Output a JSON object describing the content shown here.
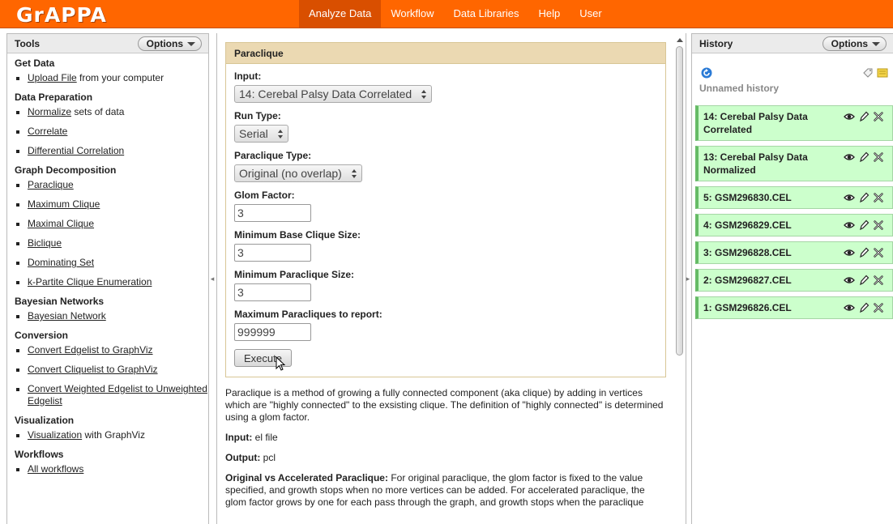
{
  "app": {
    "logo": "GrAPPA"
  },
  "nav": {
    "items": [
      {
        "label": "Analyze Data",
        "active": true
      },
      {
        "label": "Workflow",
        "active": false
      },
      {
        "label": "Data Libraries",
        "active": false
      },
      {
        "label": "Help",
        "active": false
      },
      {
        "label": "User",
        "active": false
      }
    ]
  },
  "tools": {
    "title": "Tools",
    "options_label": "Options",
    "sections": [
      {
        "name": "Get Data",
        "items": [
          {
            "link": "Upload File",
            "rest": " from your computer"
          }
        ]
      },
      {
        "name": "Data Preparation",
        "items": [
          {
            "link": "Normalize",
            "rest": " sets of data"
          },
          {
            "link": "Correlate",
            "rest": ""
          },
          {
            "link": "Differential Correlation",
            "rest": ""
          }
        ]
      },
      {
        "name": "Graph Decomposition",
        "items": [
          {
            "link": "Paraclique",
            "rest": ""
          },
          {
            "link": "Maximum Clique",
            "rest": ""
          },
          {
            "link": "Maximal Clique",
            "rest": ""
          },
          {
            "link": "Biclique",
            "rest": ""
          },
          {
            "link": "Dominating Set",
            "rest": ""
          },
          {
            "link": "k-Partite Clique Enumeration",
            "rest": ""
          }
        ]
      },
      {
        "name": "Bayesian Networks",
        "items": [
          {
            "link": "Bayesian Network",
            "rest": ""
          }
        ]
      },
      {
        "name": "Conversion",
        "items": [
          {
            "link": "Convert Edgelist to GraphViz",
            "rest": ""
          },
          {
            "link": "Convert Cliquelist to GraphViz",
            "rest": ""
          },
          {
            "link": "Convert Weighted Edgelist to Unweighted Edgelist",
            "rest": ""
          }
        ]
      },
      {
        "name": "Visualization",
        "items": [
          {
            "link": "Visualization",
            "rest": " with GraphViz"
          }
        ]
      },
      {
        "name": "Workflows",
        "items": [
          {
            "link": "All workflows",
            "rest": ""
          }
        ]
      }
    ]
  },
  "form": {
    "title": "Paraclique",
    "input_label": "Input:",
    "input_value": "14: Cerebal Palsy Data Correlated",
    "run_type_label": "Run Type:",
    "run_type_value": "Serial",
    "paraclique_type_label": "Paraclique Type:",
    "paraclique_type_value": "Original (no overlap)",
    "glom_factor_label": "Glom Factor:",
    "glom_factor_value": "3",
    "min_base_label": "Minimum Base Clique Size:",
    "min_base_value": "3",
    "min_para_label": "Minimum Paraclique Size:",
    "min_para_value": "3",
    "max_report_label": "Maximum Paracliques to report:",
    "max_report_value": "999999",
    "execute_label": "Execute"
  },
  "help": {
    "intro": "Paraclique is a method of growing a fully connected component (aka clique) by adding in vertices which are \"highly connected\" to the exsisting clique. The definition of \"highly connected\" is determined using a glom factor.",
    "input_label": "Input:",
    "input_text": " el file",
    "output_label": "Output:",
    "output_text": " pcl",
    "ova_label": "Original vs Accelerated Paraclique:",
    "ova_text": " For original paraclique, the glom factor is fixed to the value specified, and growth stops when no more vertices can be added. For accelerated paraclique, the glom factor grows by one for each pass through the graph, and growth stops when the paraclique"
  },
  "history": {
    "title": "History",
    "options_label": "Options",
    "name": "Unnamed history",
    "items": [
      {
        "label": "14: Cerebal Palsy Data Correlated"
      },
      {
        "label": "13: Cerebal Palsy Data Normalized"
      },
      {
        "label": "5: GSM296830.CEL"
      },
      {
        "label": "4: GSM296829.CEL"
      },
      {
        "label": "3: GSM296828.CEL"
      },
      {
        "label": "2: GSM296827.CEL"
      },
      {
        "label": "1: GSM296826.CEL"
      }
    ]
  },
  "colors": {
    "masthead": "#ff6600",
    "nav_active": "#d94f00",
    "history_ok": "#ccffcc",
    "form_header": "#ebd9b2"
  },
  "icons": [
    "refresh-icon",
    "tag-icon",
    "note-icon",
    "eye-icon",
    "pencil-icon",
    "delete-icon",
    "mouse-cursor-icon"
  ]
}
